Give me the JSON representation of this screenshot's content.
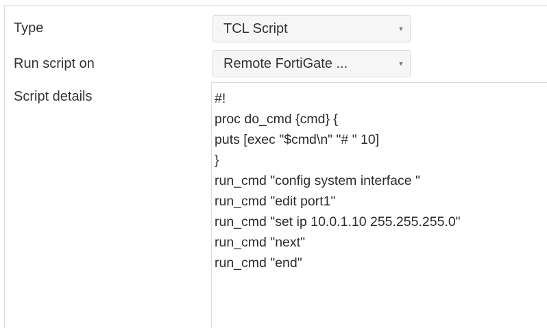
{
  "form": {
    "type": {
      "label": "Type",
      "value": "TCL Script"
    },
    "run_on": {
      "label": "Run script on",
      "value": "Remote FortiGate ..."
    },
    "details": {
      "label": "Script details",
      "lines": [
        "#!",
        "proc do_cmd {cmd} {",
        "puts [exec \"$cmd\\n\" \"# \" 10]",
        "}",
        "run_cmd \"config system interface \"",
        "run_cmd \"edit port1\"",
        "run_cmd \"set ip 10.0.1.10 255.255.255.0\"",
        "run_cmd \"next\"",
        "run_cmd \"end\""
      ]
    }
  },
  "icons": {
    "dropdown": "chevron-down-icon"
  }
}
